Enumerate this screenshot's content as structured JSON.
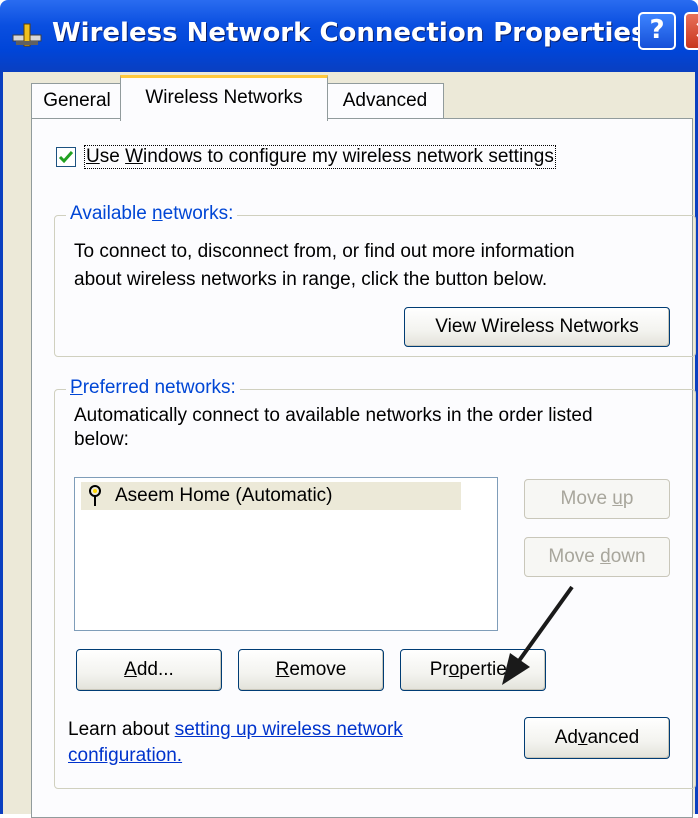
{
  "window": {
    "title": "Wireless Network Connection Properties",
    "help_label": "?",
    "close_label": "×"
  },
  "tabs": [
    {
      "label": "General",
      "selected": false
    },
    {
      "label": "Wireless Networks",
      "selected": true
    },
    {
      "label": "Advanced",
      "selected": false
    }
  ],
  "use_windows": {
    "checked": true,
    "before": "",
    "u_char": "U",
    "after": "se ",
    "w_char": "W",
    "rest": "indows to configure my wireless network settings"
  },
  "available": {
    "title_before": "Available ",
    "title_u": "n",
    "title_after": "etworks:",
    "description_line1": "To connect to, disconnect from, or find out more information",
    "description_line2": "about wireless networks in range, click the button below.",
    "view_button": "View Wireless Networks"
  },
  "preferred": {
    "title_u": "P",
    "title_after": "referred networks:",
    "description_line1": "Automatically connect to available networks in the order listed",
    "description_line2": "below:",
    "networks": [
      "Aseem Home (Automatic)"
    ],
    "move_up_before": "Move ",
    "move_up_u": "u",
    "move_up_after": "p",
    "move_down_before": "Move ",
    "move_down_u": "d",
    "move_down_after": "own",
    "add_u": "A",
    "add_after": "dd...",
    "remove_u": "R",
    "remove_after": "emove",
    "properties_before": "Pr",
    "properties_u": "o",
    "properties_after": "perties",
    "learn_text": "Learn about ",
    "learn_link_line1": "setting up wireless network",
    "learn_link_line2": "configuration.",
    "advanced_before": "Ad",
    "advanced_u": "v",
    "advanced_after": "anced"
  },
  "colors": {
    "titlebar": "#0045d8",
    "dialog_bg": "#ece9d8",
    "group_title": "#0046d5",
    "tab_highlight": "#ffc83c",
    "link": "#0033cc"
  }
}
